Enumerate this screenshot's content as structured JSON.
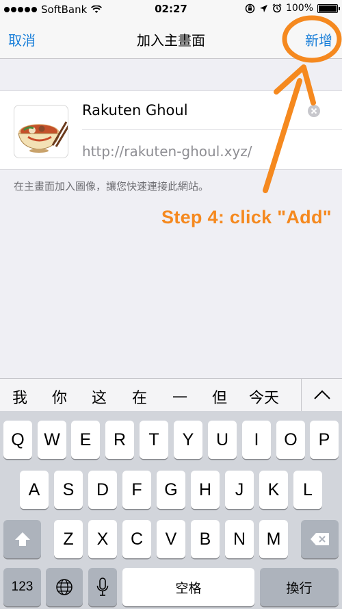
{
  "status_bar": {
    "carrier": "SoftBank",
    "time": "02:27",
    "battery": "100%",
    "icons": [
      "signal-dots",
      "wifi-icon",
      "rotation-lock-icon",
      "location-icon",
      "alarm-icon",
      "battery-icon"
    ]
  },
  "nav": {
    "cancel_label": "取消",
    "title": "加入主畫面",
    "add_label": "新增"
  },
  "form": {
    "name_value": "Rakuten Ghoul",
    "url_value": "http://rakuten-ghoul.xyz/",
    "hint": "在主畫面加入圖像，讓您快速連接此網站。"
  },
  "annotation": {
    "text": "Step 4: click \"Add\"",
    "color": "#f5891f"
  },
  "candidates": [
    "我",
    "你",
    "这",
    "在",
    "一",
    "但",
    "今天"
  ],
  "keyboard": {
    "row1": [
      "Q",
      "W",
      "E",
      "R",
      "T",
      "Y",
      "U",
      "I",
      "O",
      "P"
    ],
    "row2": [
      "A",
      "S",
      "D",
      "F",
      "G",
      "H",
      "J",
      "K",
      "L"
    ],
    "row3": [
      "Z",
      "X",
      "C",
      "V",
      "B",
      "N",
      "M"
    ],
    "numbers_label": "123",
    "space_label": "空格",
    "return_label": "換行"
  },
  "colors": {
    "accent": "#1a7fd9",
    "annotation": "#f5891f"
  }
}
